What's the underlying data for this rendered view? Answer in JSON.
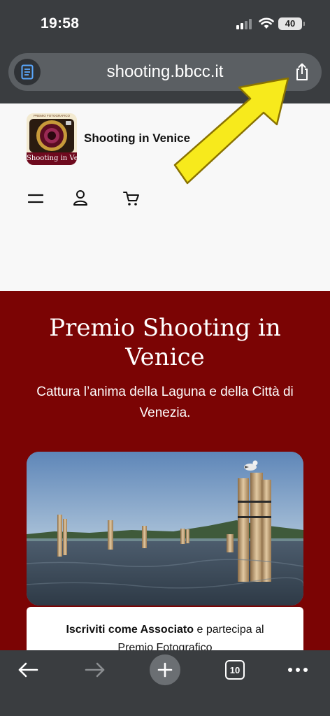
{
  "status": {
    "time": "19:58",
    "battery": "40"
  },
  "browser": {
    "url": "shooting.bbcc.it",
    "tab_count": "10"
  },
  "site": {
    "name": "Shooting in Venice",
    "logo_top_text": "PREMIO FOTOGRAFICO",
    "logo_bottom_text": "Shooting in Venice"
  },
  "hero": {
    "title": "Premio Shooting in Venice",
    "subtitle": "Cattura l’anima della Laguna e della Città di Venezia.",
    "card_bold_1": "Iscriviti come Associato",
    "card_text_1": " e partecipa al",
    "card_text_2": "Premio Fotografico"
  },
  "colors": {
    "hero_background": "#7b0404",
    "browser_chrome": "#3a3d40",
    "arrow": "#f7ea1c"
  },
  "icons": {
    "reader": "reader-mode-icon",
    "share": "share-icon",
    "menu": "hamburger-menu-icon",
    "account": "user-icon",
    "cart": "cart-icon",
    "back": "back-arrow-icon",
    "forward": "forward-arrow-icon",
    "new_tab": "plus-icon",
    "more": "more-icon"
  }
}
